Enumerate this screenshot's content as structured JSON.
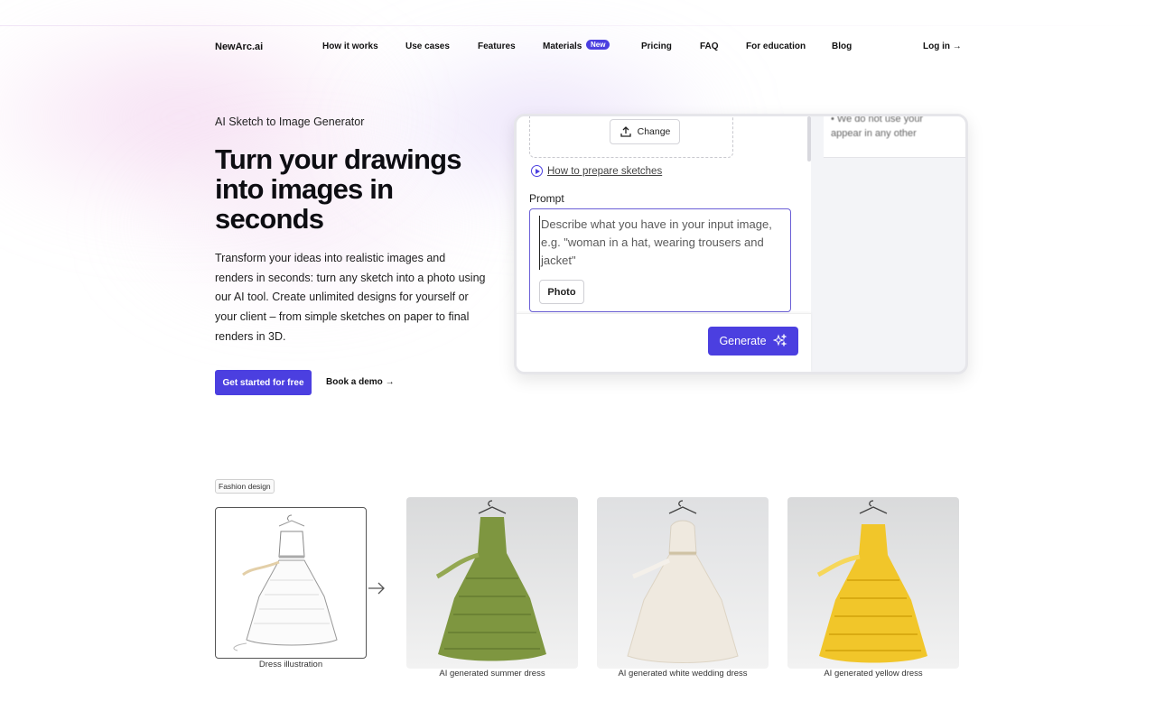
{
  "nav": {
    "brand": "NewArc.ai",
    "items": [
      "How it works",
      "Use cases",
      "Features",
      "Materials",
      "Pricing",
      "FAQ",
      "For education",
      "Blog"
    ],
    "materials_badge": "New",
    "login": "Log in →"
  },
  "hero": {
    "eyebrow": "AI Sketch to Image Generator",
    "headline": "Turn your drawings into images in seconds",
    "description": "Transform your ideas into realistic images and renders in seconds: turn any sketch into a photo using our AI tool. Create unlimited designs for yourself or your client – from simple sketches on paper to final renders in 3D.",
    "cta_primary": "Get started for free",
    "cta_secondary": "Book a demo →"
  },
  "app": {
    "change_label": "Change",
    "howto_label": "How to prepare sketches",
    "prompt_label": "Prompt",
    "prompt_placeholder": "Describe what you have in your input image, e.g. \"woman in a hat, wearing trousers and jacket\"",
    "photo_label": "Photo",
    "generate_label": "Generate",
    "note_line1": "• We do not use your",
    "note_line2": "appear in any other"
  },
  "gallery": {
    "tag": "Fashion design",
    "items": [
      {
        "caption": "Dress illustration",
        "color": "#ffffff"
      },
      {
        "caption": "AI generated summer dress",
        "color": "#7e9640"
      },
      {
        "caption": "AI generated white wedding dress",
        "color": "#efe9df"
      },
      {
        "caption": "AI generated yellow dress",
        "color": "#f1c62a"
      }
    ]
  },
  "colors": {
    "accent": "#4b3fe0"
  }
}
